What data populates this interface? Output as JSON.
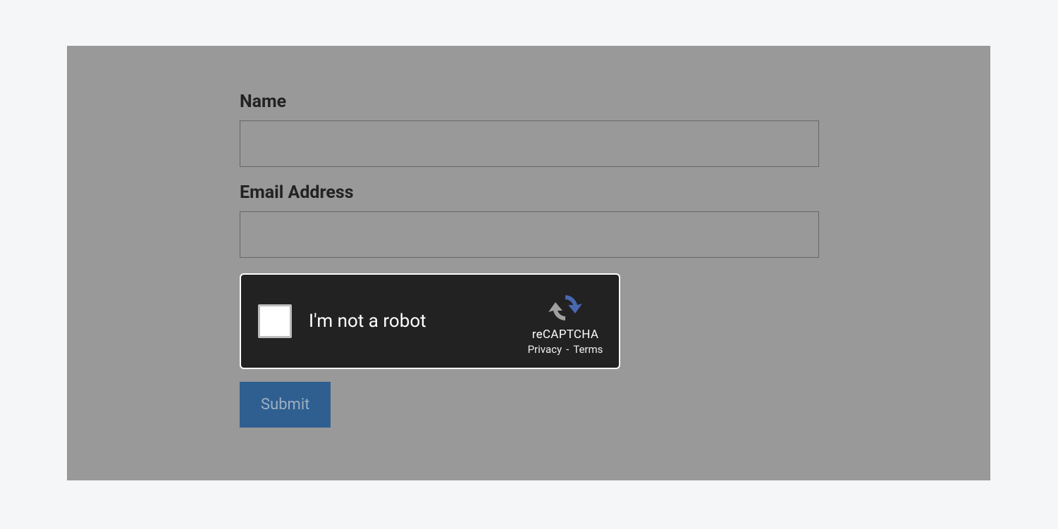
{
  "form": {
    "name_label": "Name",
    "name_value": "",
    "email_label": "Email Address",
    "email_value": ""
  },
  "recaptcha": {
    "label": "I'm not a robot",
    "brand": "reCAPTCHA",
    "privacy_label": "Privacy",
    "separator": "-",
    "terms_label": "Terms"
  },
  "submit": {
    "label": "Submit"
  }
}
